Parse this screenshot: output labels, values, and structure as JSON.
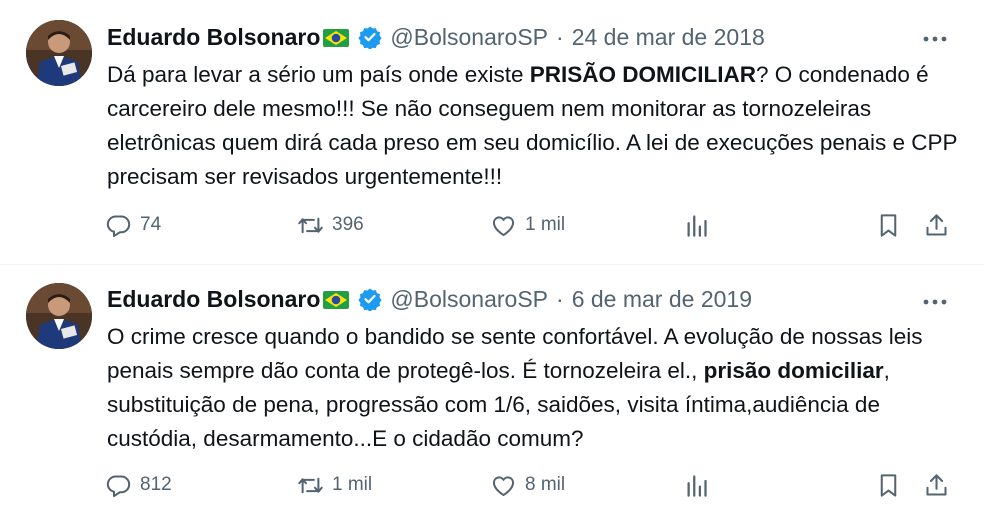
{
  "tweets": [
    {
      "author": "Eduardo Bolsonaro",
      "handle": "@BolsonaroSP",
      "separator": "·",
      "date": "24 de mar de 2018",
      "text_before": "Dá para levar a sério um país onde existe ",
      "text_bold": "PRISÃO DOMICILIAR",
      "text_after": "? O condenado é carcereiro dele mesmo!!! Se não conseguem nem monitorar as tornozeleiras eletrônicas quem dirá cada preso em seu domicílio. A lei de execuções penais e CPP precisam ser revisados urgentemente!!!",
      "replies": "74",
      "retweets": "396",
      "likes": "1 mil"
    },
    {
      "author": "Eduardo Bolsonaro",
      "handle": "@BolsonaroSP",
      "separator": "·",
      "date": "6 de mar de 2019",
      "text_before": "O crime cresce quando o bandido se sente confortável. A evolução de nossas leis penais sempre dão conta de protegê-los. É tornozeleira el., ",
      "text_bold": "prisão domiciliar",
      "text_after": ", substituição de pena, progressão com 1/6, saidões, visita íntima,audiência de custódia, desarmamento...E o cidadão comum?",
      "replies": "812",
      "retweets": "1 mil",
      "likes": "8 mil"
    }
  ],
  "icons": {
    "flag": "brazil-flag-icon",
    "verified": "verified-badge-icon",
    "more": "more-icon",
    "reply": "reply-icon",
    "retweet": "retweet-icon",
    "like": "heart-icon",
    "views": "views-icon",
    "bookmark": "bookmark-icon",
    "share": "share-icon"
  },
  "colors": {
    "text": "#0f1419",
    "secondary": "#536471",
    "verified": "#1d9bf0",
    "divider": "#eff3f4"
  }
}
